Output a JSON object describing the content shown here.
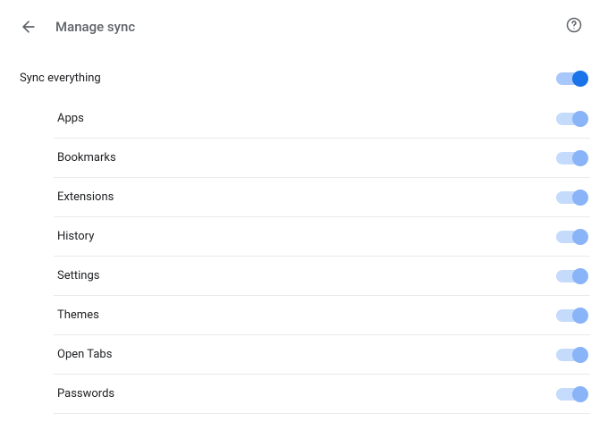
{
  "header": {
    "title": "Manage sync"
  },
  "master": {
    "label": "Sync everything",
    "enabled": true
  },
  "items": [
    {
      "label": "Apps",
      "enabled": true
    },
    {
      "label": "Bookmarks",
      "enabled": true
    },
    {
      "label": "Extensions",
      "enabled": true
    },
    {
      "label": "History",
      "enabled": true
    },
    {
      "label": "Settings",
      "enabled": true
    },
    {
      "label": "Themes",
      "enabled": true
    },
    {
      "label": "Open Tabs",
      "enabled": true
    },
    {
      "label": "Passwords",
      "enabled": true
    }
  ]
}
